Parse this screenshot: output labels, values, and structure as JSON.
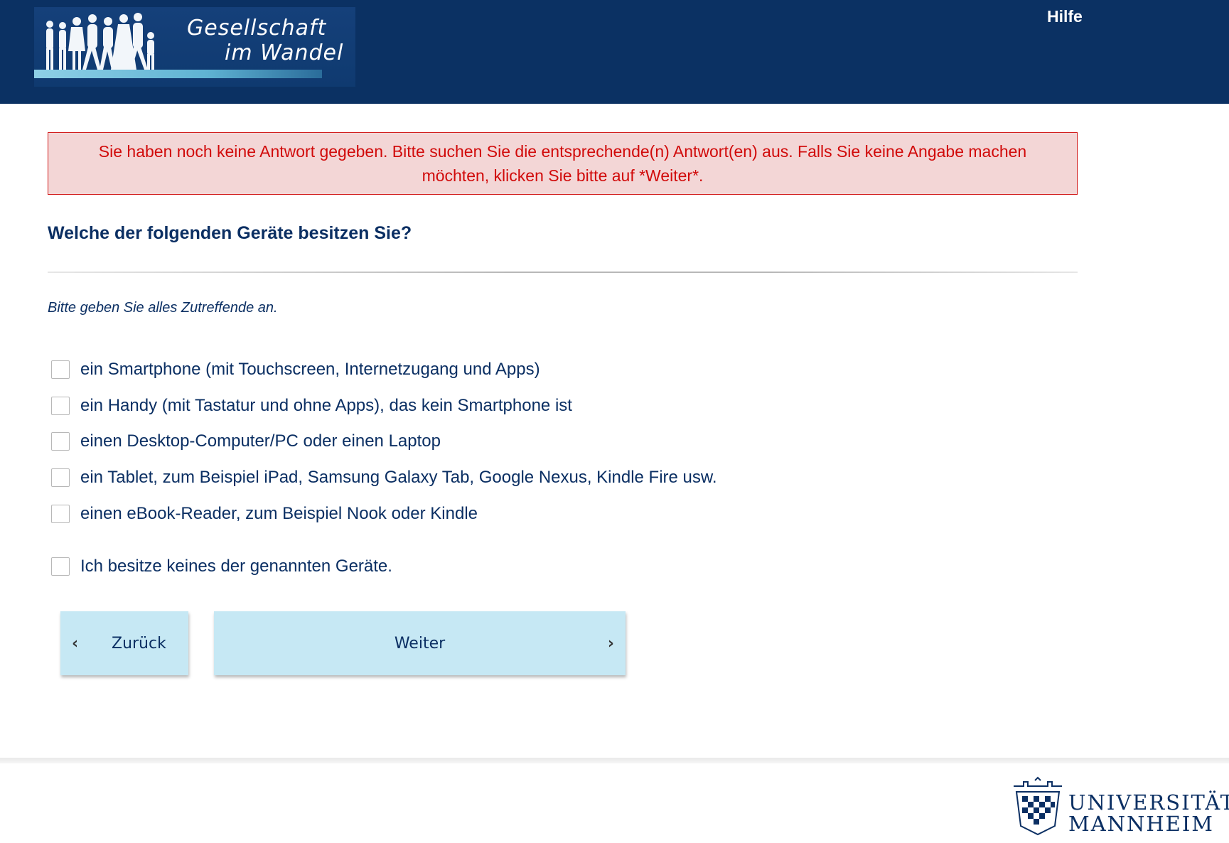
{
  "header": {
    "logo_line1": "Gesellschaft",
    "logo_line2": "im Wandel",
    "help_label": "Hilfe",
    "background_color": "#0b3163"
  },
  "error": {
    "message": "Sie haben noch keine Antwort gegeben. Bitte suchen Sie die entsprechende(n) Antwort(en) aus. Falls Sie keine Angabe machen möchten, klicken Sie bitte auf *Weiter*.",
    "text_color": "#d10a0a",
    "background_color": "#f3d6d6"
  },
  "question": {
    "text": "Welche der folgenden Geräte besitzen Sie?",
    "instruction": "Bitte geben Sie alles Zutreffende an.",
    "options": [
      {
        "label": "ein Smartphone (mit Touchscreen, Internetzugang und Apps)",
        "checked": false
      },
      {
        "label": "ein Handy (mit Tastatur und ohne Apps), das kein Smartphone ist",
        "checked": false
      },
      {
        "label": "einen Desktop-Computer/PC oder einen Laptop",
        "checked": false
      },
      {
        "label": "ein Tablet, zum Beispiel iPad, Samsung Galaxy Tab, Google Nexus, Kindle Fire usw.",
        "checked": false
      },
      {
        "label": "einen eBook-Reader, zum Beispiel Nook oder Kindle",
        "checked": false
      },
      {
        "label": "Ich besitze keines der genannten Geräte.",
        "checked": false
      }
    ]
  },
  "navigation": {
    "back_label": "Zurück",
    "next_label": "Weiter",
    "button_color": "#c6e8f4"
  },
  "footer": {
    "university_line1": "UNIVERSITÄT",
    "university_line2": "MANNHEIM"
  }
}
